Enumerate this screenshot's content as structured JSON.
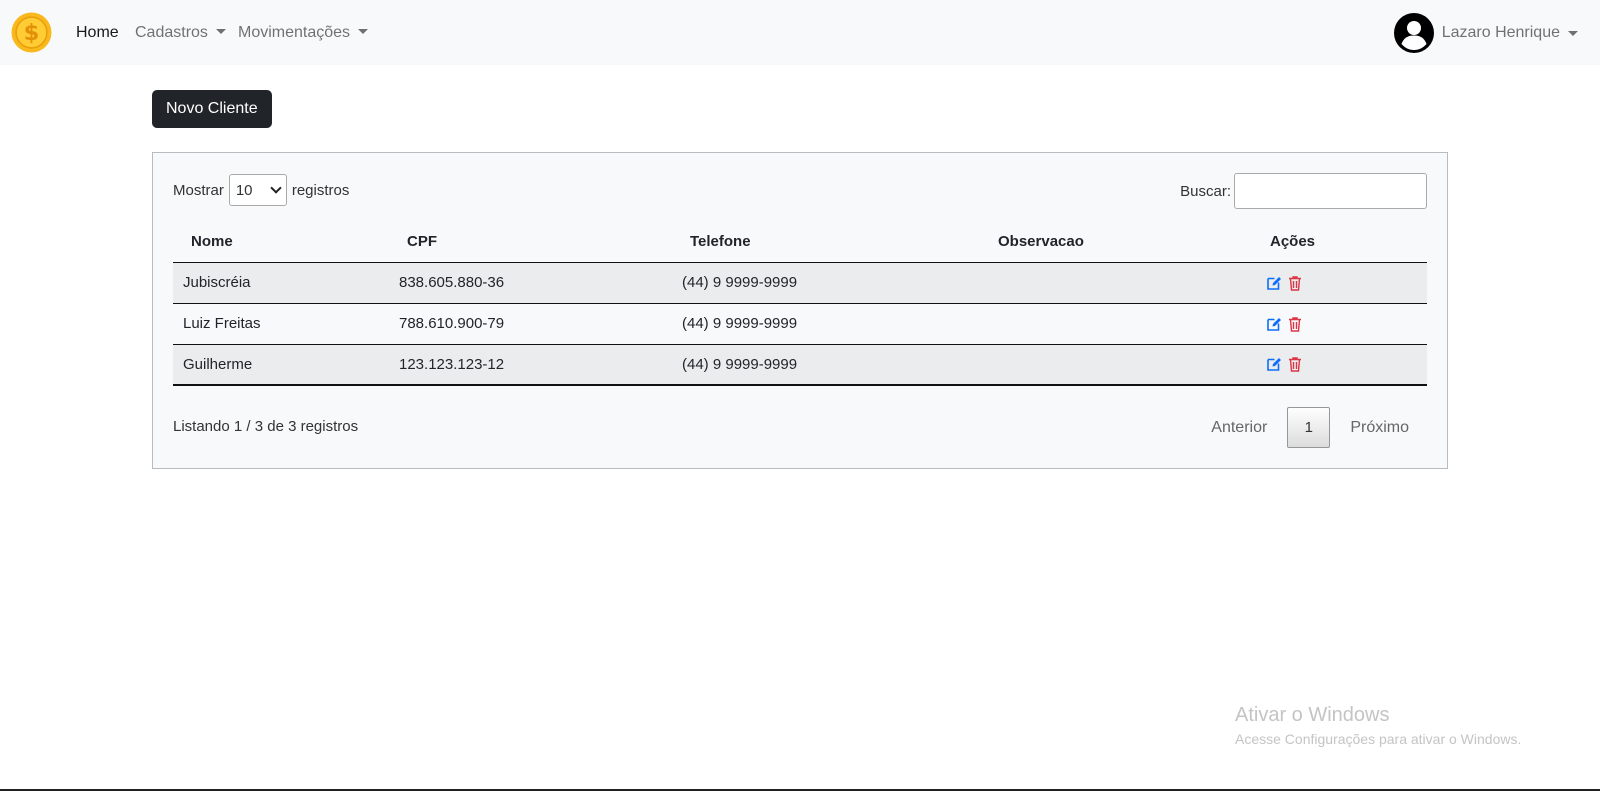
{
  "navbar": {
    "logo": "dollar-coin-icon",
    "items": [
      {
        "label": "Home",
        "active": true,
        "dropdown": false
      },
      {
        "label": "Cadastros",
        "active": false,
        "dropdown": true
      },
      {
        "label": "Movimentações",
        "active": false,
        "dropdown": true
      }
    ],
    "user": {
      "name": "Lazaro Henrique",
      "icon": "user-circle-icon"
    }
  },
  "toolbar": {
    "new_client_label": "Novo Cliente"
  },
  "table_controls": {
    "show_prefix": "Mostrar",
    "page_size": "10",
    "show_suffix": "registros",
    "search_label": "Buscar:",
    "search_value": ""
  },
  "table": {
    "headers": [
      "Nome",
      "CPF",
      "Telefone",
      "Observacao",
      "Ações"
    ],
    "rows": [
      {
        "nome": "Jubiscréia",
        "cpf": "838.605.880-36",
        "telefone": "(44) 9 9999-9999",
        "observacao": ""
      },
      {
        "nome": "Luiz Freitas",
        "cpf": "788.610.900-79",
        "telefone": "(44) 9 9999-9999",
        "observacao": ""
      },
      {
        "nome": "Guilherme",
        "cpf": "123.123.123-12",
        "telefone": "(44) 9 9999-9999",
        "observacao": ""
      }
    ],
    "action_icons": [
      "edit-icon",
      "trash-icon"
    ]
  },
  "footer": {
    "info": "Listando 1 / 3 de 3 registros",
    "prev_label": "Anterior",
    "current_page": "1",
    "next_label": "Próximo"
  },
  "watermark": {
    "title": "Ativar o Windows",
    "subtitle": "Acesse Configurações para ativar o Windows."
  },
  "colors": {
    "navbar_bg": "#f8f9fa",
    "primary_button": "#212529",
    "edit_icon": "#0d6efd",
    "delete_icon": "#dc3545",
    "logo_gold": "#f9b81b"
  }
}
